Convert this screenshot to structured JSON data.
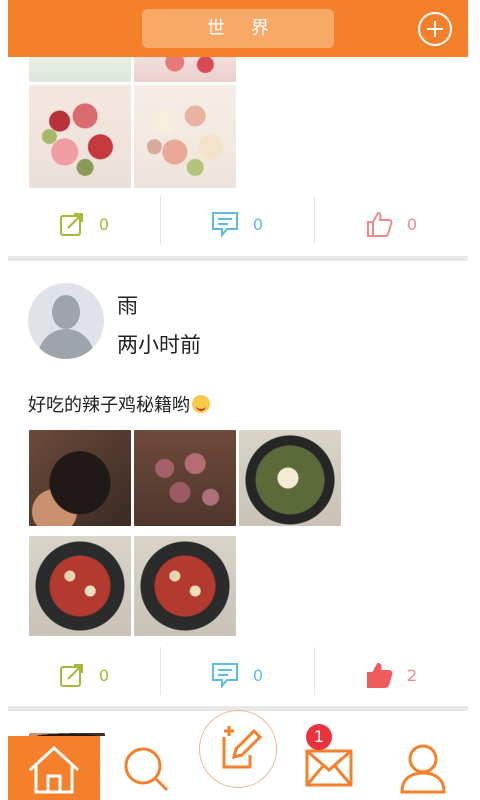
{
  "header": {
    "title": "世界"
  },
  "posts": [
    {
      "actions": {
        "share_count": "0",
        "comment_count": "0",
        "like_count": "0"
      }
    },
    {
      "author": "雨",
      "time": "两小时前",
      "text": "好吃的辣子鸡秘籍哟",
      "actions": {
        "share_count": "0",
        "comment_count": "0",
        "like_count": "2"
      }
    }
  ],
  "nav": {
    "messages_badge": "1"
  },
  "colors": {
    "accent": "#f4802b",
    "share": "#a8b834",
    "comment": "#5bbde6",
    "like": "#f08a8a",
    "like_active": "#ef5a5a",
    "badge": "#e8323c"
  },
  "icons": [
    "plus-circle-icon",
    "share-icon",
    "comment-icon",
    "like-icon",
    "home-icon",
    "search-icon",
    "compose-icon",
    "mail-icon",
    "profile-icon"
  ]
}
